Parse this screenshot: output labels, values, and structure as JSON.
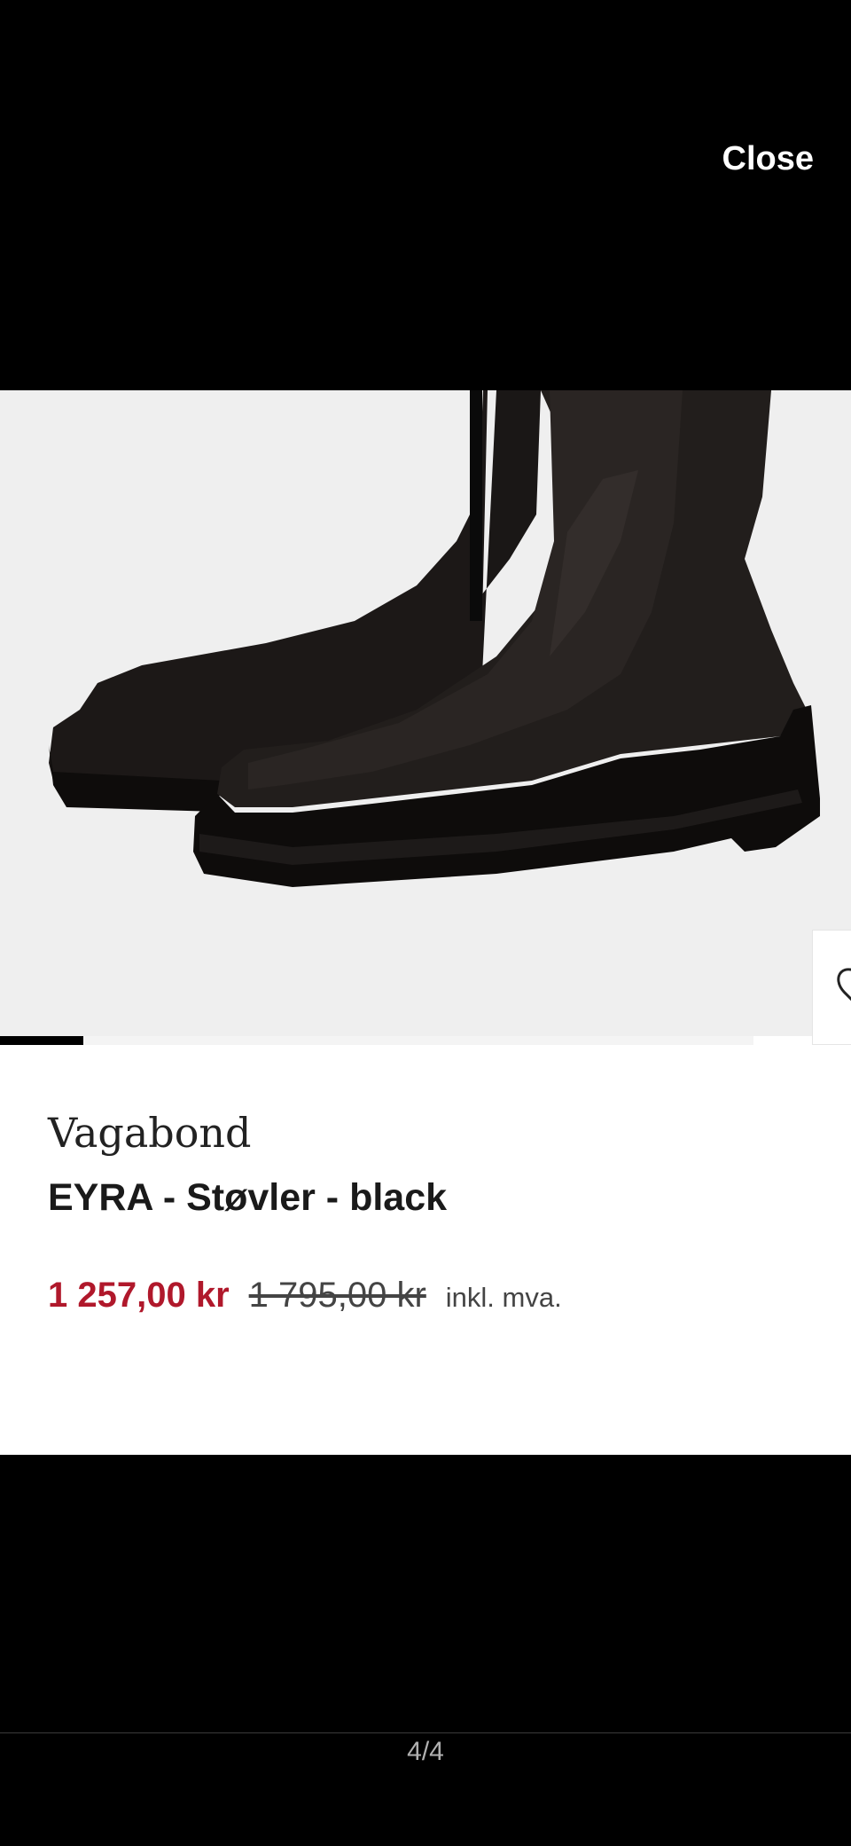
{
  "viewer": {
    "close_label": "Close",
    "pager_text": "4/4"
  },
  "product": {
    "brand": "Vagabond",
    "name": "EYRA - Støvler - black",
    "price_sale": "1 257,00 kr",
    "price_original": "1 795,00 kr",
    "price_vat_note": "inkl. mva.",
    "image_progress_fraction": 0.11
  },
  "colors": {
    "sale_price": "#b0182b",
    "image_background": "#efefef"
  }
}
